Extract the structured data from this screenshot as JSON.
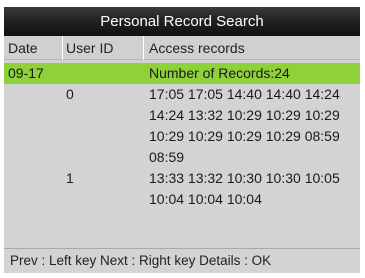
{
  "title": "Personal Record Search",
  "columns": {
    "date": "Date",
    "user_id": "User ID",
    "access_records": "Access records"
  },
  "rows": [
    {
      "date": "09-17",
      "user_id": "",
      "records": "Number of Records:24",
      "selected": true
    },
    {
      "date": "",
      "user_id": "0",
      "records": "17:05 17:05 14:40 14:40 14:24"
    },
    {
      "date": "",
      "user_id": "",
      "records": "14:24 13:32 10:29 10:29 10:29"
    },
    {
      "date": "",
      "user_id": "",
      "records": "10:29 10:29 10:29 10:29 08:59"
    },
    {
      "date": "",
      "user_id": "",
      "records": "08:59"
    },
    {
      "date": "",
      "user_id": "1",
      "records": "13:33 13:32 10:30 10:30 10:05"
    },
    {
      "date": "",
      "user_id": "",
      "records": "10:04 10:04 10:04"
    }
  ],
  "footer": "Prev : Left key   Next : Right key   Details : OK",
  "colors": {
    "title_bg": "#1a1a1a",
    "header_bg": "#cfd0cf",
    "body_bg": "#d3d3d3",
    "selected_bg": "#8fd13a"
  }
}
